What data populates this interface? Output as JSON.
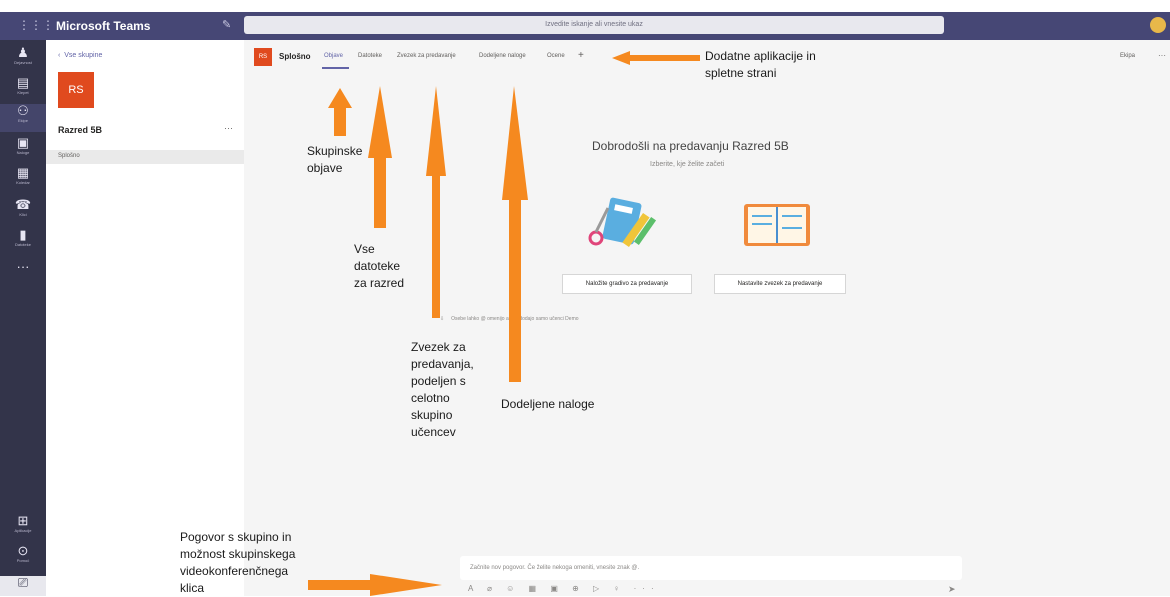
{
  "app": {
    "name": "Microsoft Teams",
    "search_placeholder": "Izvedite iskanje ali vnesite ukaz"
  },
  "rail": {
    "items": [
      {
        "icon": "bell-icon",
        "label": "Dejavnost"
      },
      {
        "icon": "chat-icon",
        "label": "Klepet"
      },
      {
        "icon": "teams-icon",
        "label": "Ekipe"
      },
      {
        "icon": "assignments-icon",
        "label": "Naloge"
      },
      {
        "icon": "calendar-icon",
        "label": "Koledar"
      },
      {
        "icon": "phone-icon",
        "label": "Klici"
      },
      {
        "icon": "files-icon",
        "label": "Datoteke"
      },
      {
        "icon": "more-icon",
        "label": ""
      },
      {
        "icon": "apps-icon",
        "label": "Aplikacije"
      },
      {
        "icon": "help-icon",
        "label": "Pomoč"
      }
    ]
  },
  "team": {
    "back_label": "Vse skupine",
    "initials": "RS",
    "name": "Razred 5B",
    "more": "···",
    "channel": "Splošno"
  },
  "channel": {
    "icon_text": "RS",
    "title": "Splošno",
    "tabs": [
      "Objave",
      "Datoteke",
      "Zvezek za predavanje",
      "Dodeljene naloge",
      "Ocene"
    ],
    "add_tab": "+",
    "right_label": "Ekipa",
    "more": "···"
  },
  "welcome": {
    "title": "Dobrodošli na predavanju Razred 5B",
    "subtitle": "Izberite, kje želite začeti",
    "button_1": "Naložite gradivo za predavanje",
    "button_2": "Nastavite zvezek za predavanje",
    "notice": "Osebe lahko @ omenijo ali pa dodajo samo učenci Demo"
  },
  "compose": {
    "placeholder": "Začnite nov pogovor. Če želite nekoga omeniti, vnesite znak @.",
    "tools": "A ⌀ ☺ ▦ ▣ ⊕ ▷ ♀ ···",
    "send": "➤"
  },
  "annotations": {
    "apps": [
      "Dodatne aplikacije in",
      "spletne strani"
    ],
    "posts": [
      "Skupinske",
      "objave"
    ],
    "files": [
      "Vse",
      "datoteke",
      "za razred"
    ],
    "notebook": [
      "Zvezek za",
      "predavanja,",
      "podeljen s",
      "celotno",
      "skupino",
      "učencev"
    ],
    "assignments": [
      "Dodeljene naloge"
    ],
    "chat": [
      "Pogovor s skupino in",
      "možnost skupinskega",
      "videokonferenčnega",
      "klica"
    ]
  },
  "colors": {
    "accent": "#6264a7",
    "rail": "#33344a",
    "titlebar": "#464775",
    "team_tile": "#e04a1e",
    "arrow": "#f5891f"
  }
}
